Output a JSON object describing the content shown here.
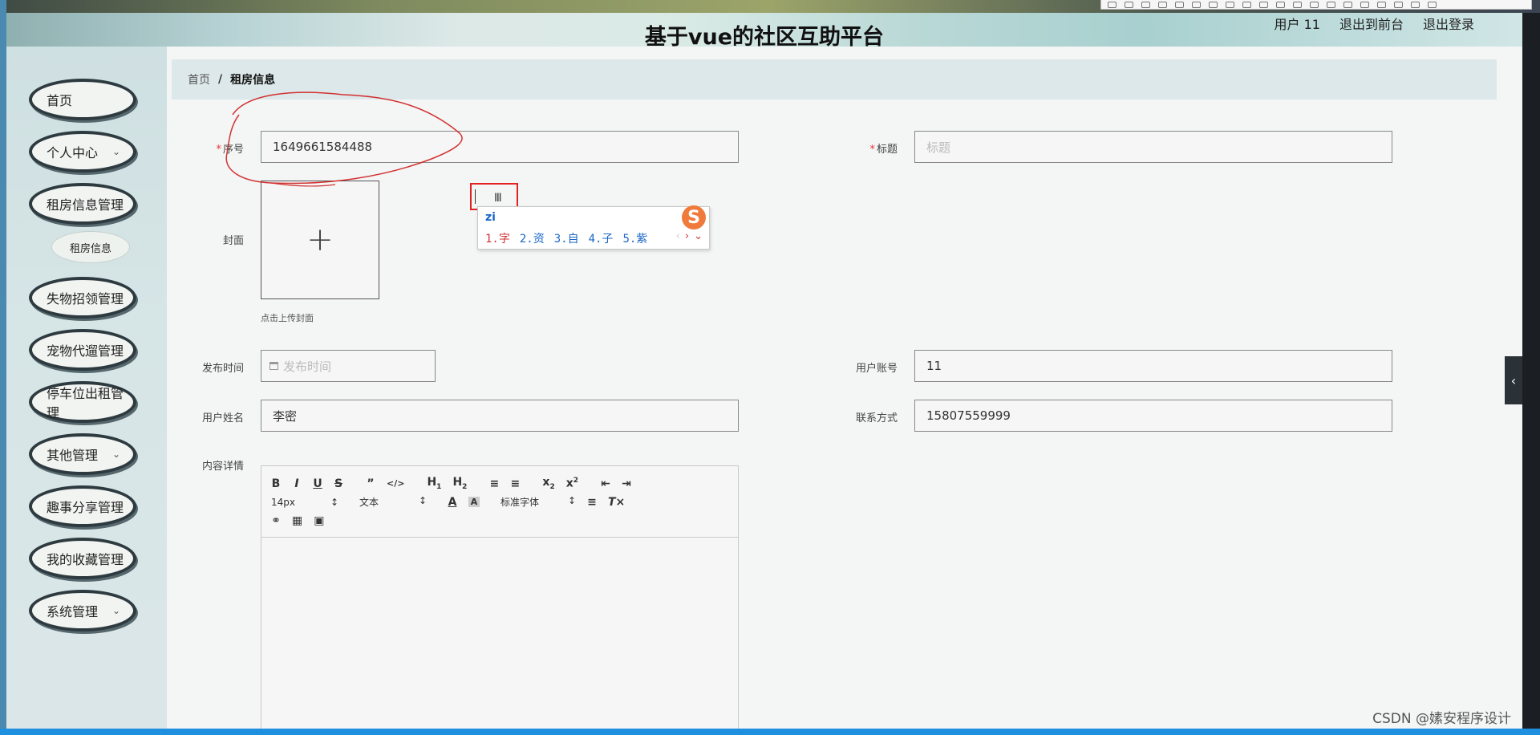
{
  "header": {
    "title": "基于vue的社区互助平台",
    "user_label": "用户 11",
    "back_to_front": "退出到前台",
    "logout": "退出登录"
  },
  "sidebar": {
    "items": [
      {
        "label": "首页",
        "has_arrow": false
      },
      {
        "label": "个人中心",
        "has_arrow": true
      },
      {
        "label": "租房信息管理",
        "has_arrow": false
      },
      {
        "label": "失物招领管理",
        "has_arrow": false
      },
      {
        "label": "宠物代遛管理",
        "has_arrow": false
      },
      {
        "label": "停车位出租管理",
        "has_arrow": false
      },
      {
        "label": "其他管理",
        "has_arrow": true
      },
      {
        "label": "趣事分享管理",
        "has_arrow": false
      },
      {
        "label": "我的收藏管理",
        "has_arrow": false
      },
      {
        "label": "系统管理",
        "has_arrow": true
      }
    ],
    "sub_item": "租房信息"
  },
  "breadcrumb": {
    "home": "首页",
    "sep": "/",
    "current": "租房信息"
  },
  "form": {
    "serial_label": "序号",
    "serial_value": "1649661584488",
    "title_label": "标题",
    "title_placeholder": "标题",
    "cover_label": "封面",
    "upload_icon": "+",
    "upload_hint": "点击上传封面",
    "publish_label": "发布时间",
    "publish_placeholder": "发布时间",
    "account_label": "用户账号",
    "account_value": "11",
    "username_label": "用户姓名",
    "username_value": "李密",
    "contact_label": "联系方式",
    "contact_value": "15807559999",
    "content_label": "内容详情"
  },
  "editor": {
    "font_size": "14px",
    "text_type": "文本",
    "font_family": "标准字体"
  },
  "ime": {
    "input": "zi",
    "candidates": [
      "1.字",
      "2.资",
      "3.自",
      "4.子",
      "5.紫"
    ],
    "logo": "S"
  },
  "watermark": "CSDN @嫊安程序设计",
  "colors": {
    "accent": "#1f8fe0",
    "required": "#e33333",
    "annotation": "#d23232"
  }
}
